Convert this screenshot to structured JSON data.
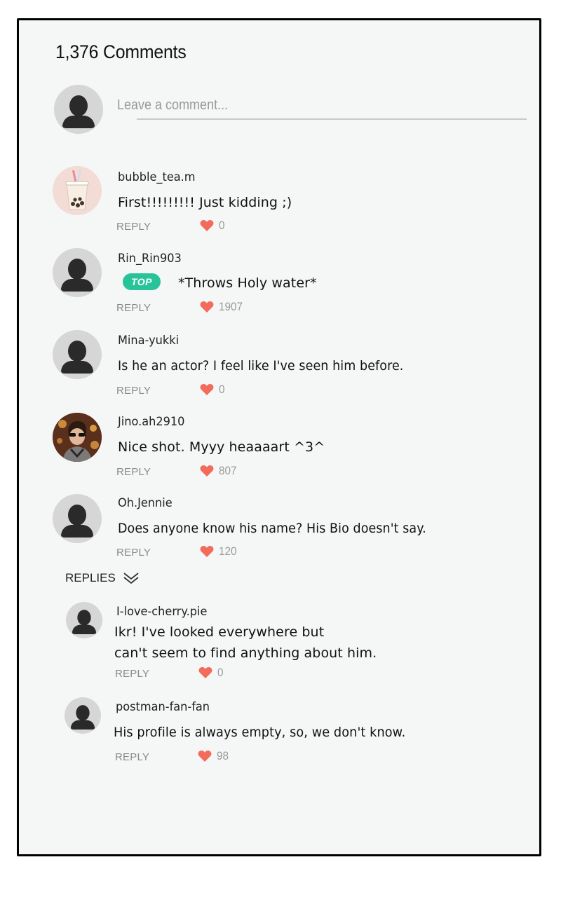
{
  "header": {
    "comment_count": "1,376 Comments"
  },
  "composer": {
    "placeholder": "Leave a comment..."
  },
  "colors": {
    "heart": "#f26b5b",
    "top_badge": "#27c49a"
  },
  "comments": [
    {
      "username": "bubble_tea.m",
      "text": "First!!!!!!!!! Just kidding ;)",
      "reply_label": "REPLY",
      "likes": "0",
      "avatar": "bubble-tea-avatar"
    },
    {
      "username": "Rin_Rin903",
      "badge": "TOP",
      "text": "*Throws Holy water*",
      "reply_label": "REPLY",
      "likes": "1907",
      "avatar": "default-avatar"
    },
    {
      "username": "Mina-yukki",
      "text": "Is he an actor? I feel like I've seen him before.",
      "reply_label": "REPLY",
      "likes": "0",
      "avatar": "default-avatar"
    },
    {
      "username": "Jino.ah2910",
      "text": "Nice shot. Myyy heaaaart ^3^",
      "reply_label": "REPLY",
      "likes": "807",
      "avatar": "photo-avatar"
    },
    {
      "username": "Oh.Jennie",
      "text": "Does anyone know his name? His Bio doesn't say.",
      "reply_label": "REPLY",
      "likes": "120",
      "avatar": "default-avatar"
    }
  ],
  "replies_toggle": {
    "label": "REPLIES",
    "icon": "double-chevron-down-icon"
  },
  "replies": [
    {
      "username": "I-love-cherry.pie",
      "text_line1": "Ikr! I've looked everywhere but",
      "text_line2": "can't seem to find anything about him.",
      "reply_label": "REPLY",
      "likes": "0",
      "avatar": "default-avatar"
    },
    {
      "username": "postman-fan-fan",
      "text": "His profile is always empty, so, we don't know.",
      "reply_label": "REPLY",
      "likes": "98",
      "avatar": "default-avatar"
    }
  ]
}
